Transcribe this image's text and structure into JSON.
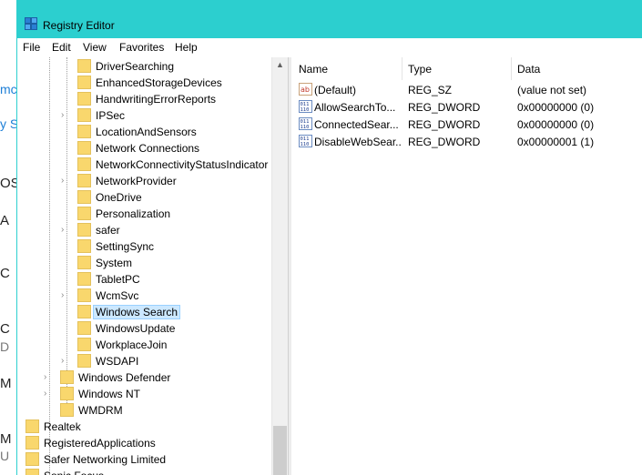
{
  "window": {
    "title": "Registry Editor"
  },
  "menu": [
    "File",
    "Edit",
    "View",
    "Favorites",
    "Help"
  ],
  "background_fragments": [
    "mc",
    "y St",
    "OS",
    "A",
    "C",
    "C",
    "D",
    "M",
    "M",
    "U"
  ],
  "tree": {
    "nodes": [
      {
        "label": "DriverSearching",
        "expander": false
      },
      {
        "label": "EnhancedStorageDevices",
        "expander": false
      },
      {
        "label": "HandwritingErrorReports",
        "expander": false
      },
      {
        "label": "IPSec",
        "expander": true
      },
      {
        "label": "LocationAndSensors",
        "expander": false
      },
      {
        "label": "Network Connections",
        "expander": false
      },
      {
        "label": "NetworkConnectivityStatusIndicator",
        "expander": false
      },
      {
        "label": "NetworkProvider",
        "expander": true
      },
      {
        "label": "OneDrive",
        "expander": false
      },
      {
        "label": "Personalization",
        "expander": false
      },
      {
        "label": "safer",
        "expander": true
      },
      {
        "label": "SettingSync",
        "expander": false
      },
      {
        "label": "System",
        "expander": false
      },
      {
        "label": "TabletPC",
        "expander": false
      },
      {
        "label": "WcmSvc",
        "expander": true
      },
      {
        "label": "Windows Search",
        "expander": false,
        "selected": true
      },
      {
        "label": "WindowsUpdate",
        "expander": false
      },
      {
        "label": "WorkplaceJoin",
        "expander": false
      },
      {
        "label": "WSDAPI",
        "expander": true
      },
      {
        "label": "Windows Defender",
        "expander": true
      },
      {
        "label": "Windows NT",
        "expander": true
      },
      {
        "label": "WMDRM",
        "expander": false
      },
      {
        "label": "Realtek",
        "expander": false
      },
      {
        "label": "RegisteredApplications",
        "expander": false
      },
      {
        "label": "Safer Networking Limited",
        "expander": false
      },
      {
        "label": "Sonic Focus",
        "expander": false
      }
    ]
  },
  "values_table": {
    "headers": [
      "Name",
      "Type",
      "Data"
    ],
    "rows": [
      {
        "icon": "string-value-icon",
        "name": "(Default)",
        "type": "REG_SZ",
        "data": "(value not set)"
      },
      {
        "icon": "dword-value-icon",
        "name": "AllowSearchTo...",
        "type": "REG_DWORD",
        "data": "0x00000000 (0)"
      },
      {
        "icon": "dword-value-icon",
        "name": "ConnectedSear...",
        "type": "REG_DWORD",
        "data": "0x00000000 (0)"
      },
      {
        "icon": "dword-value-icon",
        "name": "DisableWebSear...",
        "type": "REG_DWORD",
        "data": "0x00000001 (1)"
      }
    ]
  },
  "colors": {
    "titlebar": "#2ccfcf",
    "selection": "#cce8ff",
    "folder": "#f9d76d"
  }
}
